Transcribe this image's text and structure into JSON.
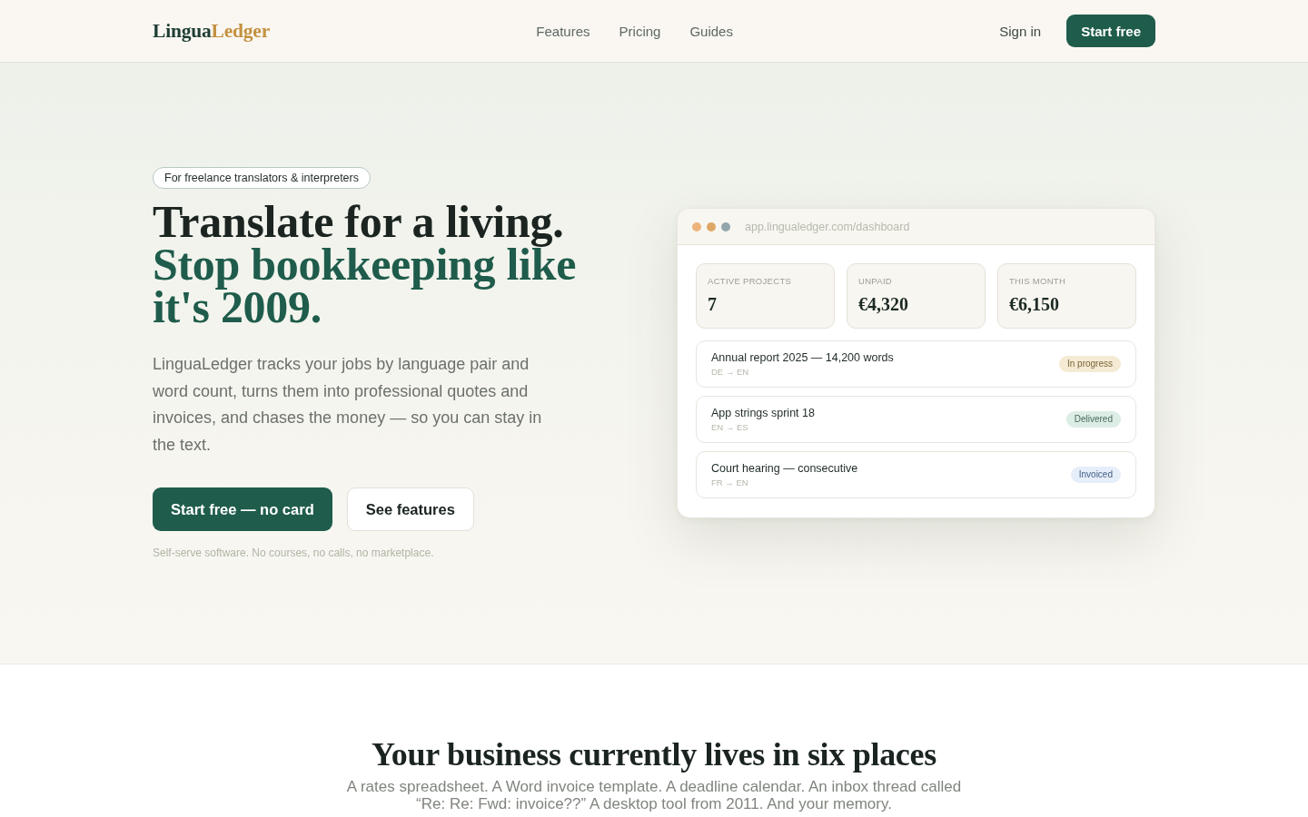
{
  "header": {
    "logo": {
      "first": "Lingua",
      "second": "Ledger"
    },
    "nav": [
      "Features",
      "Pricing",
      "Guides"
    ],
    "sign_in": "Sign in",
    "cta": "Start free"
  },
  "hero": {
    "eyebrow": "For freelance translators & interpreters",
    "title": "Translate for a living.",
    "title_accent": "Stop bookkeeping like it's 2009.",
    "description": "LinguaLedger tracks your jobs by language pair and word count, turns them into professional quotes and invoices, and chases the money — so you can stay in the text.",
    "primary_button": "Start free — no card",
    "secondary_button": "See features",
    "note": "Self-serve software. No courses, no calls, no marketplace."
  },
  "dashboard": {
    "url": "app.lingualedger.com/dashboard",
    "stats": [
      {
        "label": "ACTIVE PROJECTS",
        "value": "7"
      },
      {
        "label": "UNPAID",
        "value": "€4,320"
      },
      {
        "label": "THIS MONTH",
        "value": "€6,150"
      }
    ],
    "projects": [
      {
        "title": "Annual report 2025 — 14,200 words",
        "languages": "DE → EN",
        "status": {
          "label": "In progress",
          "color": "#f5ead3"
        }
      },
      {
        "title": "App strings sprint 18",
        "languages": "EN → ES",
        "status": {
          "label": "Delivered",
          "color": "#dcede5"
        }
      },
      {
        "title": "Court hearing — consecutive",
        "languages": "FR → EN",
        "status": {
          "label": "Invoiced",
          "color": "#e6eef9"
        }
      }
    ]
  },
  "section": {
    "title": "Your business currently lives in six places",
    "text": "A rates spreadsheet. A Word invoice template. A deadline calendar. An inbox thread called “Re: Re: Fwd: invoice??” A desktop tool from 2011. And your memory."
  }
}
